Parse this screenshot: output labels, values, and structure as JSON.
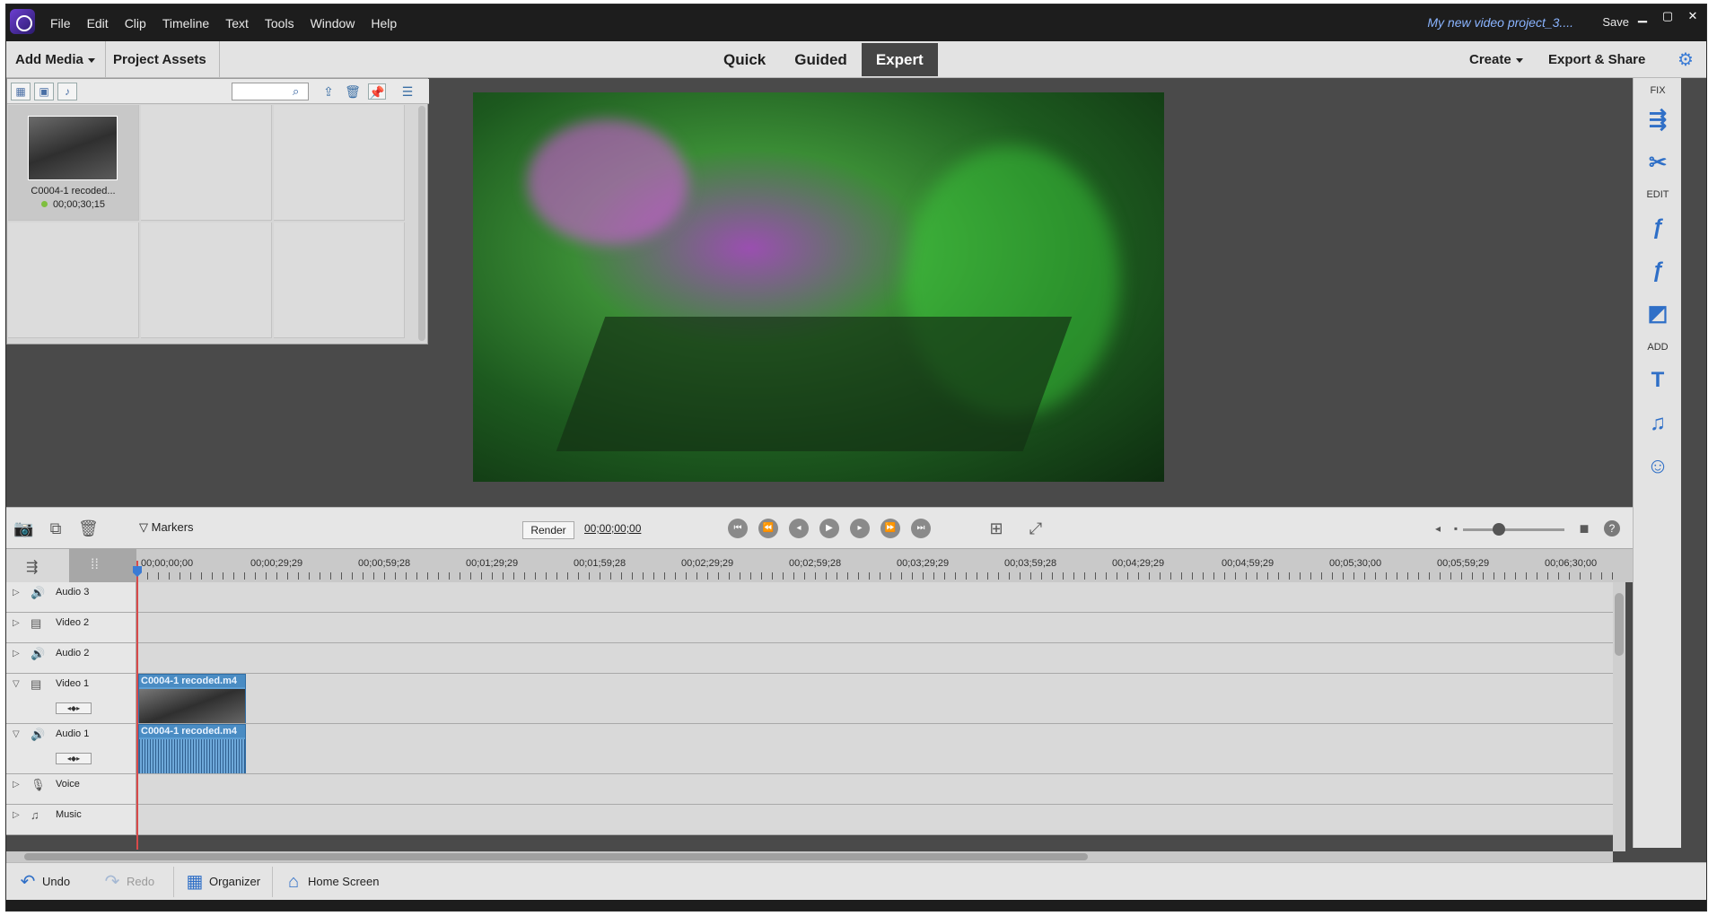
{
  "titlebar": {
    "menu": [
      "File",
      "Edit",
      "Clip",
      "Timeline",
      "Text",
      "Tools",
      "Window",
      "Help"
    ],
    "project_name": "My new video project_3....",
    "save_label": "Save",
    "minimize": "▁",
    "maximize": "▢",
    "close": "✕"
  },
  "toolbar": {
    "add_media": "Add Media",
    "project_assets": "Project Assets",
    "tabs": [
      "Quick",
      "Guided",
      "Expert"
    ],
    "active_tab": "Expert",
    "create": "Create",
    "export_share": "Export & Share"
  },
  "assets": {
    "search_placeholder": "",
    "items": [
      {
        "name": "C0004-1 recoded...",
        "duration": "00;00;30;15"
      }
    ]
  },
  "right_panel": {
    "sections": {
      "fix": "FIX",
      "edit": "EDIT",
      "add": "ADD"
    }
  },
  "timeline": {
    "markers_label": "Markers",
    "render_label": "Render",
    "timecode": "00;00;00;00",
    "ruler_labels": [
      "00;00;00;00",
      "00;00;29;29",
      "00;00;59;28",
      "00;01;29;29",
      "00;01;59;28",
      "00;02;29;29",
      "00;02;59;28",
      "00;03;29;29",
      "00;03;59;28",
      "00;04;29;29",
      "00;04;59;29",
      "00;05;30;00",
      "00;05;59;29",
      "00;06;30;00"
    ],
    "tracks": [
      {
        "name": "Audio 3"
      },
      {
        "name": "Video 2"
      },
      {
        "name": "Audio 2"
      },
      {
        "name": "Video 1"
      },
      {
        "name": "Audio 1"
      },
      {
        "name": "Voice"
      },
      {
        "name": "Music"
      }
    ],
    "video_clip": "C0004-1 recoded.m4",
    "audio_clip": "C0004-1 recoded.m4"
  },
  "bottombar": {
    "undo": "Undo",
    "redo": "Redo",
    "organizer": "Organizer",
    "home_screen": "Home Screen"
  },
  "colors": {
    "accent": "#3a7bd5",
    "playhead": "#d84a4a",
    "clip": "#5d9fd4"
  }
}
